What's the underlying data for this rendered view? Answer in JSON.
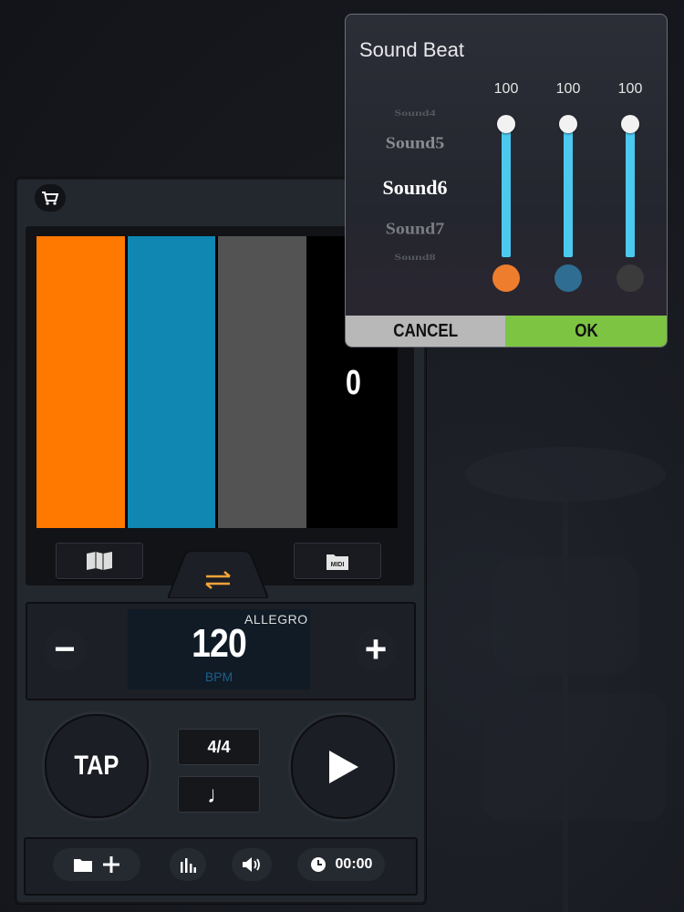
{
  "dialog": {
    "title": "Sound Beat",
    "sounds": [
      "Sound4",
      "Sound5",
      "Sound6",
      "Sound7",
      "Sound8"
    ],
    "selected_sound": "Sound6",
    "volumes": [
      "100",
      "100",
      "100"
    ],
    "beat_colors": [
      "#ee7d2e",
      "#2f6e92",
      "#3b3b3b"
    ],
    "cancel_label": "CANCEL",
    "ok_label": "OK"
  },
  "metronome": {
    "beat_colors": [
      "#ff7800",
      "#0f87b2",
      "#535353",
      "#000000"
    ],
    "beat_count": "0",
    "midi_label": "MIDI",
    "tempo_name": "ALLEGRO",
    "bpm": "120",
    "bpm_label": "BPM",
    "minus_label": "−",
    "plus_label": "+",
    "tap_label": "TAP",
    "time_signature": "4/4",
    "note_value": "♩",
    "timer": "00:00"
  },
  "accent_color": "#f2a33a"
}
